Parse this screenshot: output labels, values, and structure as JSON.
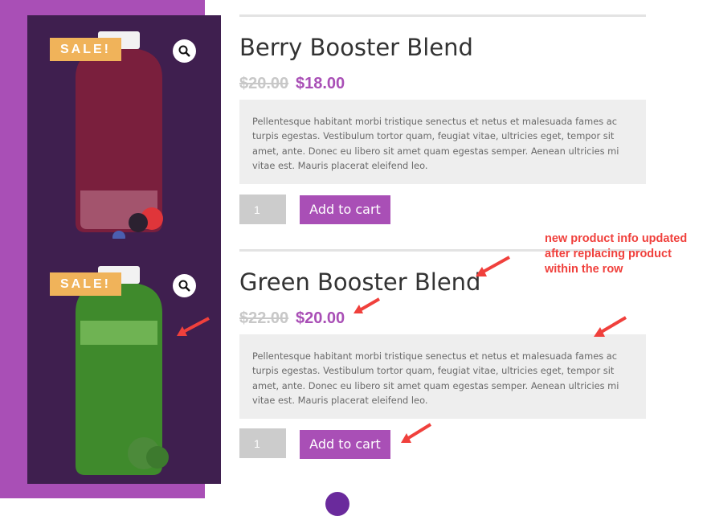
{
  "products": [
    {
      "sale_badge": "SALE!",
      "title": "Berry Booster Blend",
      "old_price": "$20.00",
      "new_price": "$18.00",
      "description": "Pellentesque habitant morbi tristique senectus et netus et malesuada fames ac turpis egestas. Vestibulum tortor quam, feugiat vitae, ultricies eget, tempor sit amet, ante. Donec eu libero sit amet quam egestas semper. Aenean ultricies mi vitae est. Mauris placerat eleifend leo.",
      "quantity": "1",
      "add_to_cart_label": "Add to cart",
      "bottle_color": "#7a1f3d"
    },
    {
      "sale_badge": "SALE!",
      "title": "Green Booster Blend",
      "old_price": "$22.00",
      "new_price": "$20.00",
      "description": "Pellentesque habitant morbi tristique senectus et netus et malesuada fames ac turpis egestas. Vestibulum tortor quam, feugiat vitae, ultricies eget, tempor sit amet, ante. Donec eu libero sit amet quam egestas semper. Aenean ultricies mi vitae est. Mauris placerat eleifend leo.",
      "quantity": "1",
      "add_to_cart_label": "Add to cart",
      "bottle_color": "#3f8a2c"
    }
  ],
  "annotation": {
    "text": "new product info updated after replacing product within the row"
  },
  "colors": {
    "accent": "#a94fb6",
    "image_background": "#3f1f4f",
    "sale_badge": "#f0b35a",
    "annotation": "#f0403c"
  },
  "icons": {
    "zoom": "magnifier-icon",
    "arrow": "red-arrow-icon"
  }
}
